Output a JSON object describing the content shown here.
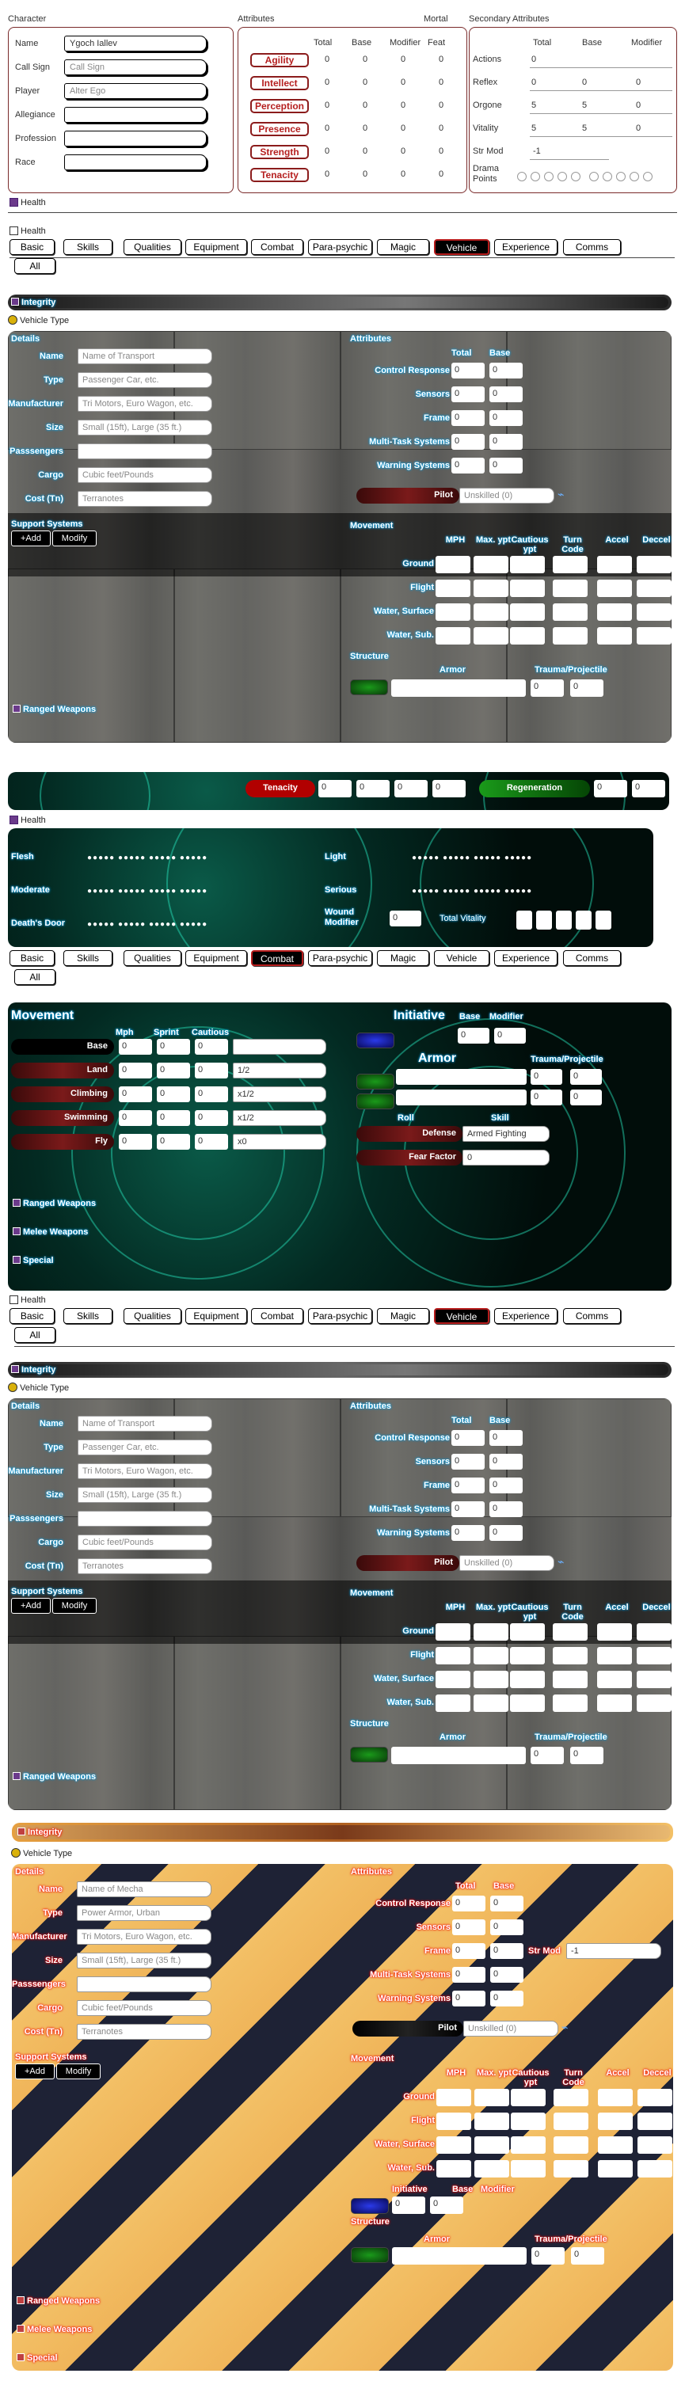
{
  "header": {
    "character_title": "Character",
    "attributes_title": "Attributes",
    "mortal_label": "Mortal",
    "secondary_title": "Secondary Attributes",
    "fields": [
      {
        "label": "Name",
        "value": "Ygoch Iallev"
      },
      {
        "label": "Call Sign",
        "value": "Call Sign"
      },
      {
        "label": "Player",
        "value": "Alter Ego"
      },
      {
        "label": "Allegiance",
        "value": ""
      },
      {
        "label": "Profession",
        "value": ""
      },
      {
        "label": "Race",
        "value": ""
      }
    ],
    "attr_cols": [
      "Total",
      "Base",
      "Modifier",
      "Feat"
    ],
    "attributes": [
      {
        "name": "Agility",
        "total": "0",
        "base": "0",
        "modifier": "0",
        "feat": "0"
      },
      {
        "name": "Intellect",
        "total": "0",
        "base": "0",
        "modifier": "0",
        "feat": "0"
      },
      {
        "name": "Perception",
        "total": "0",
        "base": "0",
        "modifier": "0",
        "feat": "0"
      },
      {
        "name": "Presence",
        "total": "0",
        "base": "0",
        "modifier": "0",
        "feat": "0"
      },
      {
        "name": "Strength",
        "total": "0",
        "base": "0",
        "modifier": "0",
        "feat": "0"
      },
      {
        "name": "Tenacity",
        "total": "0",
        "base": "0",
        "modifier": "0",
        "feat": "0"
      }
    ],
    "sec_cols": [
      "Total",
      "Base",
      "Modifier"
    ],
    "secondary": [
      {
        "name": "Actions",
        "total": "0",
        "base": "",
        "modifier": ""
      },
      {
        "name": "Reflex",
        "total": "0",
        "base": "0",
        "modifier": "0"
      },
      {
        "name": "Orgone",
        "total": "5",
        "base": "5",
        "modifier": "0"
      },
      {
        "name": "Vitality",
        "total": "5",
        "base": "5",
        "modifier": "0"
      }
    ],
    "str_mod_label": "Str Mod",
    "str_mod_value": "-1",
    "drama_label": "Drama Points"
  },
  "health_toggle": "Health",
  "tabs": [
    "Basic",
    "Skills",
    "Qualities",
    "Equipment",
    "Combat",
    "Para-psychic",
    "Magic",
    "Vehicle",
    "Experience",
    "Comms",
    "All"
  ],
  "vehicle": {
    "integrity": "Integrity",
    "vehicle_type": "Vehicle Type",
    "details_title": "Details",
    "attributes_title": "Attributes",
    "details": [
      {
        "label": "Name",
        "placeholder": "Name of Transport"
      },
      {
        "label": "Type",
        "placeholder": "Passenger Car, etc."
      },
      {
        "label": "Manufacturer",
        "placeholder": "Tri Motors, Euro Wagon, etc."
      },
      {
        "label": "Size",
        "placeholder": "Small (15ft), Large (35 ft.)"
      },
      {
        "label": "Passsengers",
        "placeholder": ""
      },
      {
        "label": "Cargo",
        "placeholder": "Cubic feet/Pounds"
      },
      {
        "label": "Cost (Tn)",
        "placeholder": "Terranotes"
      }
    ],
    "attr_cols": [
      "Total",
      "Base"
    ],
    "attrs": [
      {
        "name": "Control Response",
        "total": "0",
        "base": "0"
      },
      {
        "name": "Sensors",
        "total": "0",
        "base": "0"
      },
      {
        "name": "Frame",
        "total": "0",
        "base": "0"
      },
      {
        "name": "Multi-Task Systems",
        "total": "0",
        "base": "0"
      },
      {
        "name": "Warning Systems",
        "total": "0",
        "base": "0"
      }
    ],
    "pilot_label": "Pilot",
    "pilot_value": "Unskilled (0)",
    "support_title": "Support Systems",
    "add_label": "+Add",
    "modify_label": "Modify",
    "movement_title": "Movement",
    "move_cols": [
      "MPH",
      "Max. ypt",
      "Cautious ypt",
      "Turn Code",
      "Accel",
      "Deccel"
    ],
    "move_rows": [
      "Ground",
      "Flight",
      "Water, Surface",
      "Water, Sub."
    ],
    "structure_title": "Structure",
    "armor_label": "Armor",
    "trauma_label": "Trauma/Projectile",
    "trauma_values": [
      "0",
      "0"
    ],
    "ranged_label": "Ranged Weapons"
  },
  "tenacity_bar": {
    "label": "Tenacity",
    "values": [
      "0",
      "0",
      "0",
      "0"
    ],
    "regen_label": "Regeneration",
    "regen_values": [
      "0",
      "0"
    ]
  },
  "health": {
    "rows": [
      {
        "label": "Flesh",
        "dots": "●●●●● ●●●●● ●●●●● ●●●●●"
      },
      {
        "label": "Moderate",
        "dots": "●●●●● ●●●●● ●●●●● ●●●●●"
      },
      {
        "label": "Death's Door",
        "dots": "●●●●● ●●●●● ●●●●● ●●●●●"
      }
    ],
    "rows_right": [
      {
        "label": "Light",
        "dots": "●●●●● ●●●●● ●●●●● ●●●●●"
      },
      {
        "label": "Serious",
        "dots": "●●●●● ●●●●● ●●●●● ●●●●●"
      }
    ],
    "wound_label": "Wound Modifier",
    "wound_value": "0",
    "total_vit_label": "Total Vitality"
  },
  "combat": {
    "movement_title": "Movement",
    "move_cols": [
      "Mph",
      "Sprint",
      "Cautious"
    ],
    "moves": [
      {
        "name": "Base",
        "mph": "0",
        "sprint": "0",
        "cautious": "0",
        "note": ""
      },
      {
        "name": "Land",
        "mph": "0",
        "sprint": "0",
        "cautious": "0",
        "note": "1/2"
      },
      {
        "name": "Climbing",
        "mph": "0",
        "sprint": "0",
        "cautious": "0",
        "note": "x1/2"
      },
      {
        "name": "Swimming",
        "mph": "0",
        "sprint": "0",
        "cautious": "0",
        "note": "x1/2"
      },
      {
        "name": "Fly",
        "mph": "0",
        "sprint": "0",
        "cautious": "0",
        "note": "x0"
      }
    ],
    "initiative_label": "Initiative",
    "init_cols": [
      "Base",
      "Modifier"
    ],
    "init_values": [
      "0",
      "0"
    ],
    "armor_label": "Armor",
    "trauma_label": "Trauma/Projectile",
    "trauma_values": [
      "0",
      "0",
      "0",
      "0"
    ],
    "roll_label": "Roll",
    "skill_label": "Skill",
    "defense_label": "Defense",
    "defense_value": "Armed Fighting",
    "fear_label": "Fear Factor",
    "fear_value": "0",
    "ranged_label": "Ranged Weapons",
    "melee_label": "Melee Weapons",
    "special_label": "Special"
  },
  "mecha": {
    "integrity": "Integrity",
    "vehicle_type": "Vehicle Type",
    "details_title": "Details",
    "attributes_title": "Attributes",
    "details": [
      {
        "label": "Name",
        "placeholder": "Name of Mecha"
      },
      {
        "label": "Type",
        "placeholder": "Power Armor, Urban"
      },
      {
        "label": "Manufacturer",
        "placeholder": "Tri Motors, Euro Wagon, etc."
      },
      {
        "label": "Size",
        "placeholder": "Small (15ft), Large (35 ft.)"
      },
      {
        "label": "Passsengers",
        "placeholder": ""
      },
      {
        "label": "Cargo",
        "placeholder": "Cubic feet/Pounds"
      },
      {
        "label": "Cost (Tn)",
        "placeholder": "Terranotes"
      }
    ],
    "attr_cols": [
      "Total",
      "Base"
    ],
    "attrs": [
      {
        "name": "Control Response",
        "total": "0",
        "base": "0"
      },
      {
        "name": "Sensors",
        "total": "0",
        "base": "0"
      },
      {
        "name": "Frame",
        "total": "0",
        "base": "0"
      },
      {
        "name": "Multi-Task Systems",
        "total": "0",
        "base": "0"
      },
      {
        "name": "Warning Systems",
        "total": "0",
        "base": "0"
      }
    ],
    "str_mod_label": "Str Mod",
    "str_mod_value": "-1",
    "pilot_label": "Pilot",
    "pilot_value": "Unskilled (0)",
    "support_title": "Support Systems",
    "add_label": "+Add",
    "modify_label": "Modify",
    "movement_title": "Movement",
    "move_cols": [
      "MPH",
      "Max. ypt",
      "Cautious ypt",
      "Turn Code",
      "Accel",
      "Deccel"
    ],
    "move_rows": [
      "Ground",
      "Flight",
      "Water, Surface",
      "Water, Sub."
    ],
    "initiative_label": "Initiative",
    "init_cols": [
      "Base",
      "Modifier"
    ],
    "init_values": [
      "0",
      "0"
    ],
    "structure_title": "Structure",
    "armor_label": "Armor",
    "trauma_label": "Trauma/Projectile",
    "trauma_values": [
      "0",
      "0"
    ],
    "ranged_label": "Ranged Weapons",
    "melee_label": "Melee Weapons",
    "special_label": "Special"
  },
  "colors": {
    "accent_red": "#b51e1e",
    "active_tab_border": "#b71c1c",
    "glow_blue": "#009ad9",
    "glow_red": "#ee0000"
  }
}
